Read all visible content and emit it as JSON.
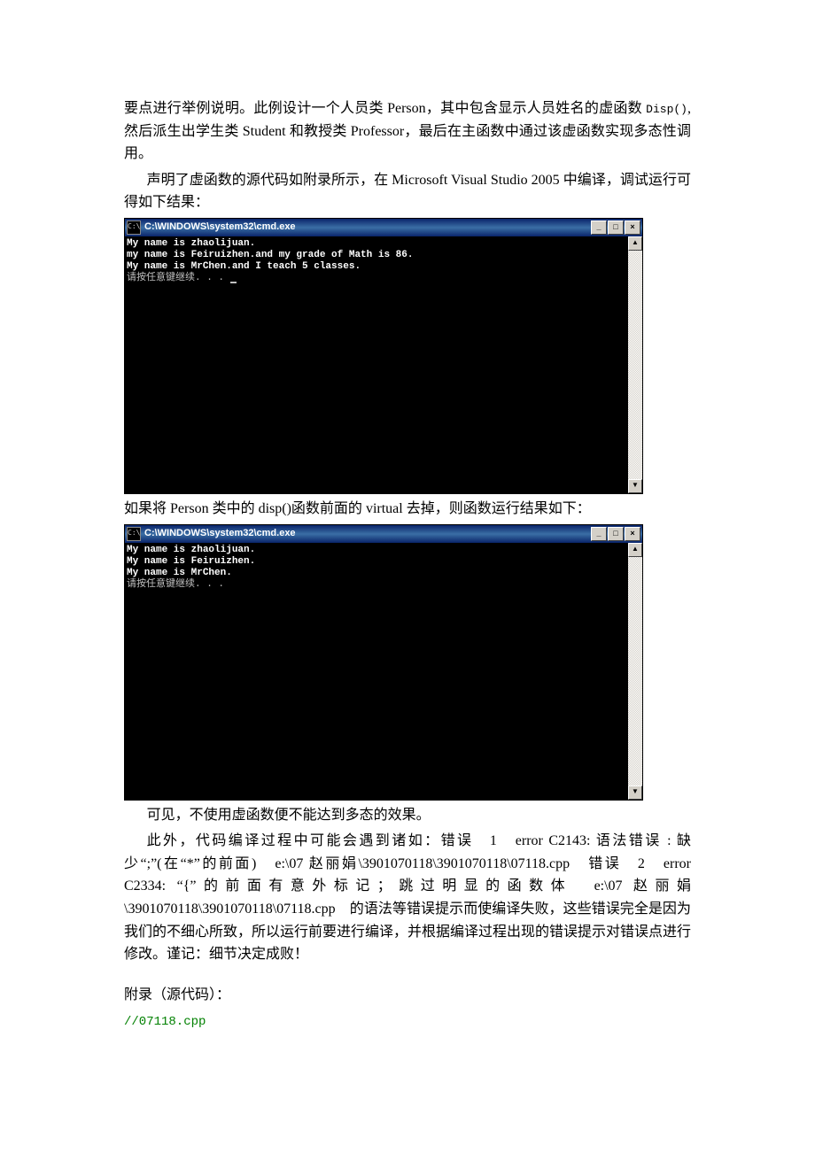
{
  "p1_a": "要点进行举例说明。此例设计一个人员类 ",
  "p1_b": "Person",
  "p1_c": "，其中包含显示人员姓名的虚函数 ",
  "p1_d": "Disp()",
  "p1_e": ",然后派生出学生类 ",
  "p1_f": "Student ",
  "p1_g": "和教授类 ",
  "p1_h": "Professor",
  "p1_i": "，最后在主函数中通过该虚函数实现多态性调用。",
  "p2_a": "声明了虚函数的源代码如附录所示，在 ",
  "p2_b": "Microsoft Visual Studio 2005 ",
  "p2_c": "中编译，调试运行可得如下结果：",
  "win1": {
    "title": "C:\\WINDOWS\\system32\\cmd.exe",
    "lines": [
      "My name is zhaolijuan.",
      "my name is Feiruizhen.and my grade of Math is 86.",
      "My name is MrChen.and I teach 5 classes.",
      "请按任意键继续. . . "
    ]
  },
  "p3_a": "如果将 ",
  "p3_b": "Person ",
  "p3_c": "类中的 ",
  "p3_d": "disp()",
  "p3_e": "函数前面的 ",
  "p3_f": "virtual ",
  "p3_g": "去掉，则函数运行结果如下：",
  "win2": {
    "title": "C:\\WINDOWS\\system32\\cmd.exe",
    "lines": [
      "My name is zhaolijuan.",
      "My name is Feiruizhen.",
      "My name is MrChen.",
      "请按任意键继续. . ."
    ]
  },
  "p4": "可见，不使用虚函数便不能达到多态的效果。",
  "p5_a": "此外，代码编译过程中可能会遇到诸如：错误　1　error C2143: 语法错误 : 缺少“;”(在“*”的前面)　e:\\07 赵丽娟\\3901070118\\3901070118\\07118.cpp　错误　2　error C2334: “{”的前面有意外标记；跳过明显的函数体　e:\\07 赵丽娟\\3901070118\\3901070118\\07118.cpp　的语法等错误提示而使编译失败，这些错误完全是因为我们的不细心所致，所以运行前要进行编译，并根据编译过程出现的错误提示对错误点进行修改。谨记：细节决定成败！",
  "appendix": "附录（源代码）：",
  "codefile": "//07118.cpp",
  "btn": {
    "min": "_",
    "max": "□",
    "close": "×",
    "up": "▲",
    "down": "▼"
  }
}
